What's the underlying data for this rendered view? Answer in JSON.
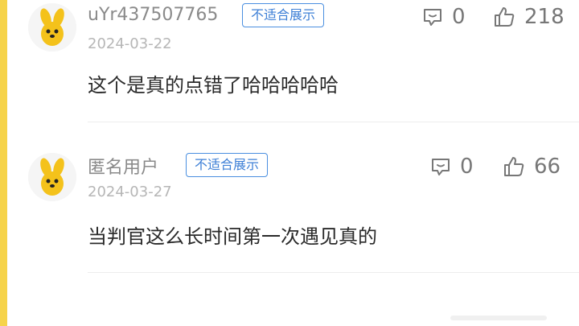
{
  "comments": [
    {
      "username": "uYr437507765",
      "badge": "不适合展示",
      "date": "2024-03-22",
      "text": "这个是真的点错了哈哈哈哈哈",
      "reply_count": "0",
      "like_count": "218"
    },
    {
      "username": "匿名用户",
      "badge": "不适合展示",
      "date": "2024-03-27",
      "text": "当判官这么长时间第一次遇见真的",
      "reply_count": "0",
      "like_count": "66"
    }
  ],
  "icons": {
    "avatar": "dog-mascot-avatar",
    "reply": "comment-icon",
    "like": "thumbs-up-icon"
  },
  "colors": {
    "accent_edge": "#f6d34a",
    "badge_blue": "#3d7fd6",
    "avatar_yellow": "#f4c21b"
  }
}
